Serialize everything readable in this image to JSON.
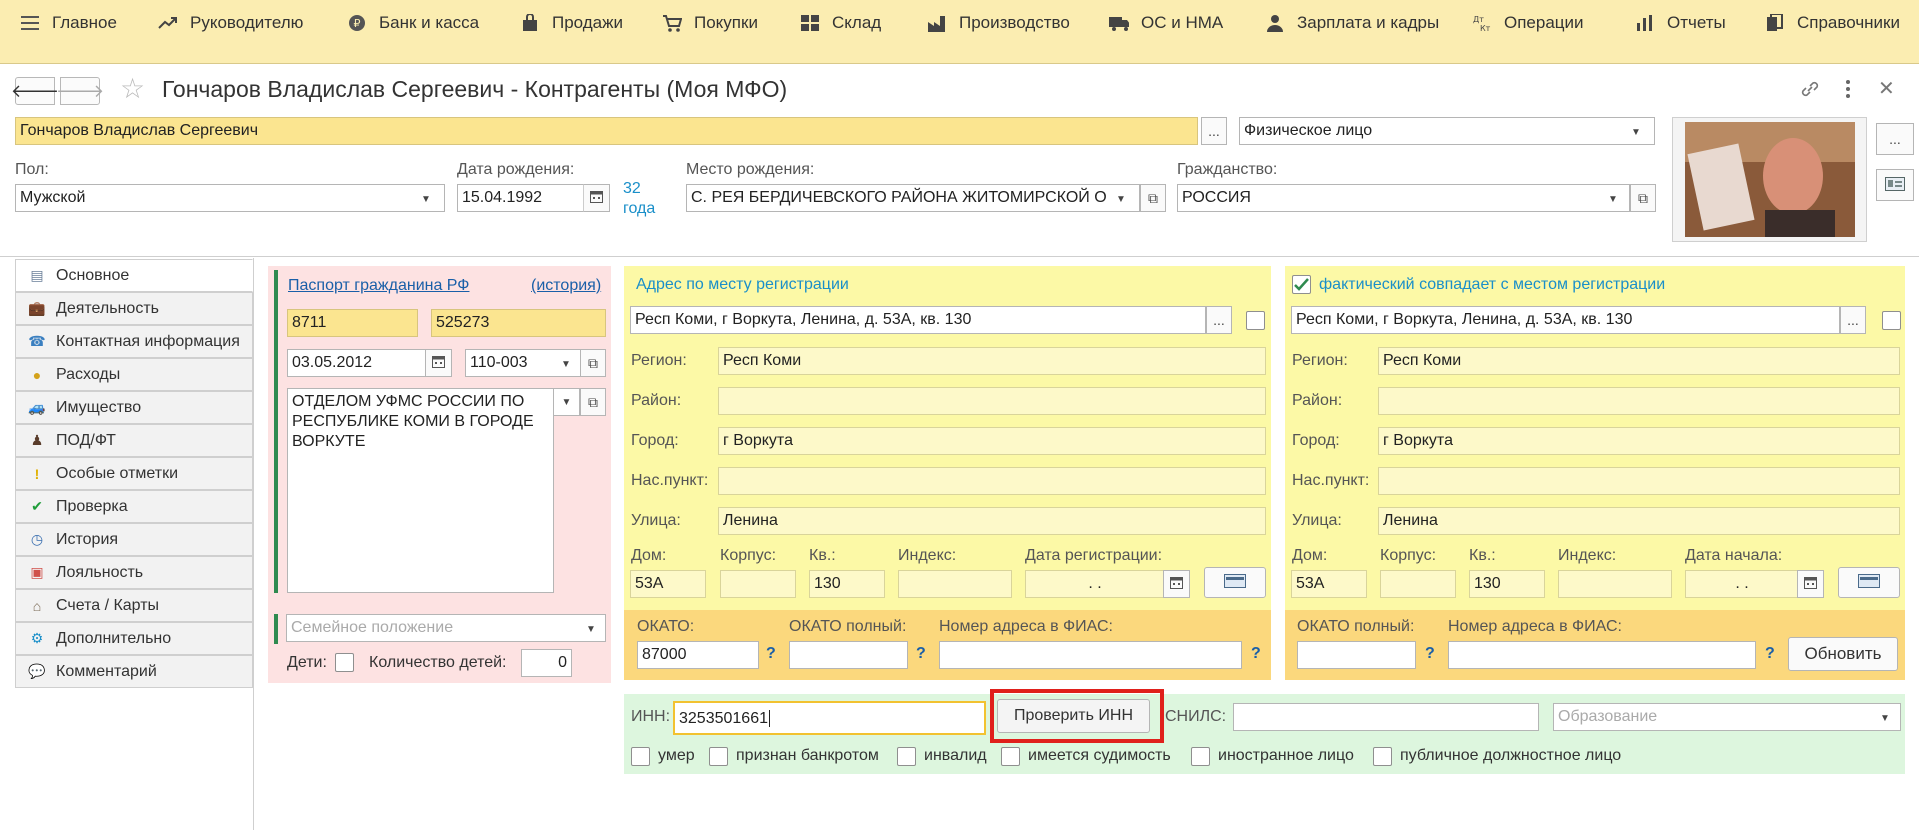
{
  "menu": {
    "items": [
      {
        "label": "Главное",
        "icon": "hamburger-icon"
      },
      {
        "label": "Руководителю",
        "icon": "chart-trend-icon"
      },
      {
        "label": "Банк и касса",
        "icon": "ruble-coin-icon"
      },
      {
        "label": "Продажи",
        "icon": "shopping-bag-icon"
      },
      {
        "label": "Покупки",
        "icon": "cart-icon"
      },
      {
        "label": "Склад",
        "icon": "warehouse-grid-icon"
      },
      {
        "label": "Производство",
        "icon": "factory-icon"
      },
      {
        "label": "ОС и НМА",
        "icon": "truck-icon"
      },
      {
        "label": "Зарплата и кадры",
        "icon": "person-icon"
      },
      {
        "label": "Операции",
        "icon": "dt-kt-icon"
      },
      {
        "label": "Отчеты",
        "icon": "bar-chart-icon"
      },
      {
        "label": "Справочники",
        "icon": "books-icon"
      }
    ]
  },
  "header": {
    "title": "Гончаров Владислав Сергеевич - Контрагенты (Моя МФО)"
  },
  "form": {
    "name_value": "Гончаров Владислав Сергеевич",
    "type_value": "Физическое лицо",
    "gender_label": "Пол:",
    "gender_value": "Мужской",
    "birthdate_label": "Дата рождения:",
    "birthdate_value": "15.04.1992",
    "age_line1": "32",
    "age_line2": "года",
    "birthplace_label": "Место рождения:",
    "birthplace_value": "С. РЕЯ БЕРДИЧЕВСКОГО РАЙОНА ЖИТОМИРСКОЙ О",
    "citizenship_label": "Гражданство:",
    "citizenship_value": "РОССИЯ",
    "dots": "..."
  },
  "tabs": [
    {
      "label": "Основное",
      "icon": "document-icon"
    },
    {
      "label": "Деятельность",
      "icon": "briefcase-icon"
    },
    {
      "label": "Контактная информация",
      "icon": "contacts-icon"
    },
    {
      "label": "Расходы",
      "icon": "coins-icon"
    },
    {
      "label": "Имущество",
      "icon": "car-plus-icon"
    },
    {
      "label": "ПОД/ФТ",
      "icon": "agent-icon"
    },
    {
      "label": "Особые отметки",
      "icon": "exclamation-icon"
    },
    {
      "label": "Проверка",
      "icon": "checkmark-icon"
    },
    {
      "label": "История",
      "icon": "clock-icon"
    },
    {
      "label": "Лояльность",
      "icon": "gift-icon"
    },
    {
      "label": "Счета / Карты",
      "icon": "bank-icon"
    },
    {
      "label": "Дополнительно",
      "icon": "gear-icon"
    },
    {
      "label": "Комментарий",
      "icon": "comment-icon"
    }
  ],
  "passport": {
    "link": "Паспорт гражданина РФ",
    "history_link": "(история)",
    "series": "8711",
    "number": "525273",
    "issue_date": "03.05.2012",
    "dept_code": "110-003",
    "issued_by": "ОТДЕЛОМ УФМС РОССИИ ПО РЕСПУБЛИКЕ КОМИ В ГОРОДЕ ВОРКУТЕ",
    "family_placeholder": "Семейное положение",
    "children_label": "Дети:",
    "children_count_label": "Количество детей:",
    "children_count": "0"
  },
  "reg_address": {
    "title": "Адрес по месту регистрации",
    "full": "Респ Коми, г Воркута, Ленина, д. 53А, кв. 130",
    "region_label": "Регион:",
    "region": "Респ Коми",
    "district_label": "Район:",
    "district": "",
    "city_label": "Город:",
    "city": "г Воркута",
    "locality_label": "Нас.пункт:",
    "locality": "",
    "street_label": "Улица:",
    "street": "Ленина",
    "house_label": "Дом:",
    "house": "53А",
    "building_label": "Корпус:",
    "building": "",
    "flat_label": "Кв.:",
    "flat": "130",
    "index_label": "Индекс:",
    "index": "",
    "reg_date_label": "Дата регистрации:",
    "reg_date": " .  .",
    "okato_label": "ОКАТО:",
    "okato": "87000",
    "okato_full_label": "ОКАТО полный:",
    "okato_full": "",
    "fias_label": "Номер адреса в ФИАС:",
    "fias": "",
    "q": "?"
  },
  "fact_address": {
    "title": "фактический совпадает с местом регистрации",
    "full": "Респ Коми, г Воркута, Ленина, д. 53А, кв. 130",
    "region": "Респ Коми",
    "city": "г Воркута",
    "street": "Ленина",
    "house": "53А",
    "flat": "130",
    "start_date_label": "Дата начала:",
    "start_date": " .  .",
    "refresh_button": "Обновить"
  },
  "inn": {
    "label": "ИНН:",
    "value": "3253501661",
    "check_button": "Проверить ИНН",
    "snils_label": "СНИЛС:",
    "snils": "",
    "education_placeholder": "Образование"
  },
  "flags": [
    {
      "label": "умер"
    },
    {
      "label": "признан банкротом"
    },
    {
      "label": "инвалид"
    },
    {
      "label": "имеется судимость"
    },
    {
      "label": "иностранное лицо"
    },
    {
      "label": "публичное должностное лицо"
    }
  ],
  "colors": {
    "menu_bg": "#fbedb1",
    "highlight_red": "#e0201b",
    "link_blue": "#1a5fa8",
    "pink_panel": "#fde2e2",
    "yellow_panel": "#fcf9a6",
    "orange_panel": "#fbd87d",
    "green_panel": "#ddf6de"
  }
}
